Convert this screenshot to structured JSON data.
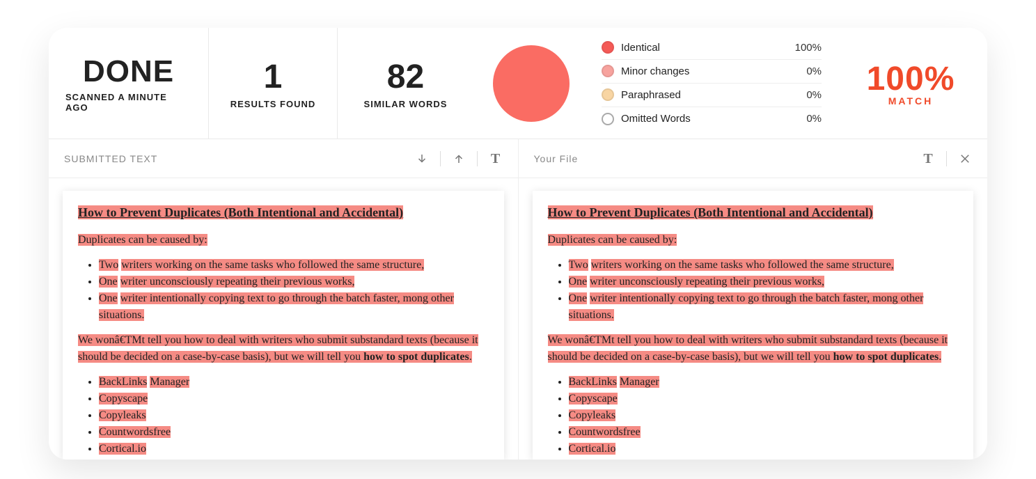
{
  "summary": {
    "status": "DONE",
    "status_sub": "SCANNED A MINUTE AGO",
    "results_count": "1",
    "results_label": "RESULTS FOUND",
    "similar_count": "82",
    "similar_label": "SIMILAR WORDS",
    "legend": [
      {
        "label": "Identical",
        "value": "100%"
      },
      {
        "label": "Minor changes",
        "value": "0%"
      },
      {
        "label": "Paraphrased",
        "value": "0%"
      },
      {
        "label": "Omitted Words",
        "value": "0%"
      }
    ],
    "match_percent": "100%",
    "match_label": "MATCH"
  },
  "left": {
    "title": "SUBMITTED TEXT"
  },
  "right": {
    "title": "Your File"
  },
  "document": {
    "heading": "How to Prevent Duplicates (Both Intentional and Accidental)",
    "intro": "Duplicates can be caused by:",
    "causes": [
      {
        "a": "Two",
        "b": "writers working on the same tasks who followed the same structure,"
      },
      {
        "a": "One",
        "b": "writer unconsciously repeating their previous works,"
      },
      {
        "a": "One",
        "b": "writer intentionally copying text to go through the batch faster, mong other situations."
      }
    ],
    "para_a": "We wonâ€TMt tell you how to deal with writers who submit substandard texts (because it should be decided on a case-by-case basis), but we will tell you ",
    "para_bold": "how to spot duplicates",
    "para_b": ".",
    "tools": [
      {
        "a": "BackLinks",
        "b": "Manager"
      },
      {
        "a": "Copyscape"
      },
      {
        "a": "Copyleaks"
      },
      {
        "a": "Countwordsfree"
      },
      {
        "a": "Cortical.io"
      }
    ]
  }
}
